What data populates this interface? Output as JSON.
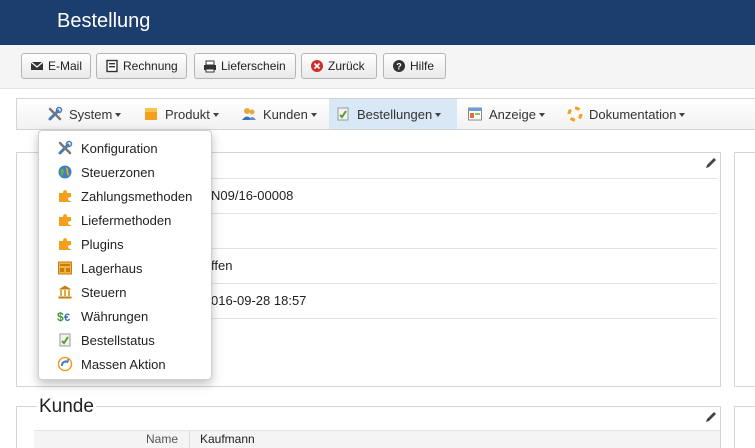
{
  "header": {
    "title": "Bestellung"
  },
  "toolbar": {
    "email": "E-Mail",
    "invoice": "Rechnung",
    "delivery_note": "Lieferschein",
    "back": "Zurück",
    "help": "Hilfe"
  },
  "menu": {
    "system": "System",
    "product": "Produkt",
    "customers": "Kunden",
    "orders": "Bestellungen",
    "display": "Anzeige",
    "documentation": "Dokumentation"
  },
  "system_menu": {
    "items": [
      "Konfiguration",
      "Steuerzonen",
      "Zahlungsmethoden",
      "Liefermethoden",
      "Plugins",
      "Lagerhaus",
      "Steuern",
      "Währungen",
      "Bestellstatus",
      "Massen Aktion"
    ]
  },
  "order_panel": {
    "values": [
      "N09/16-00008",
      "ffen",
      "016-09-28 18:57"
    ]
  },
  "customer_section": {
    "legend": "Kunde",
    "first_label": "Name",
    "first_value": "Kaufmann"
  },
  "colors": {
    "header_bg": "#1b3e6f",
    "active_menu_bg": "#d9e8f6",
    "back_icon": "#c9302c"
  }
}
